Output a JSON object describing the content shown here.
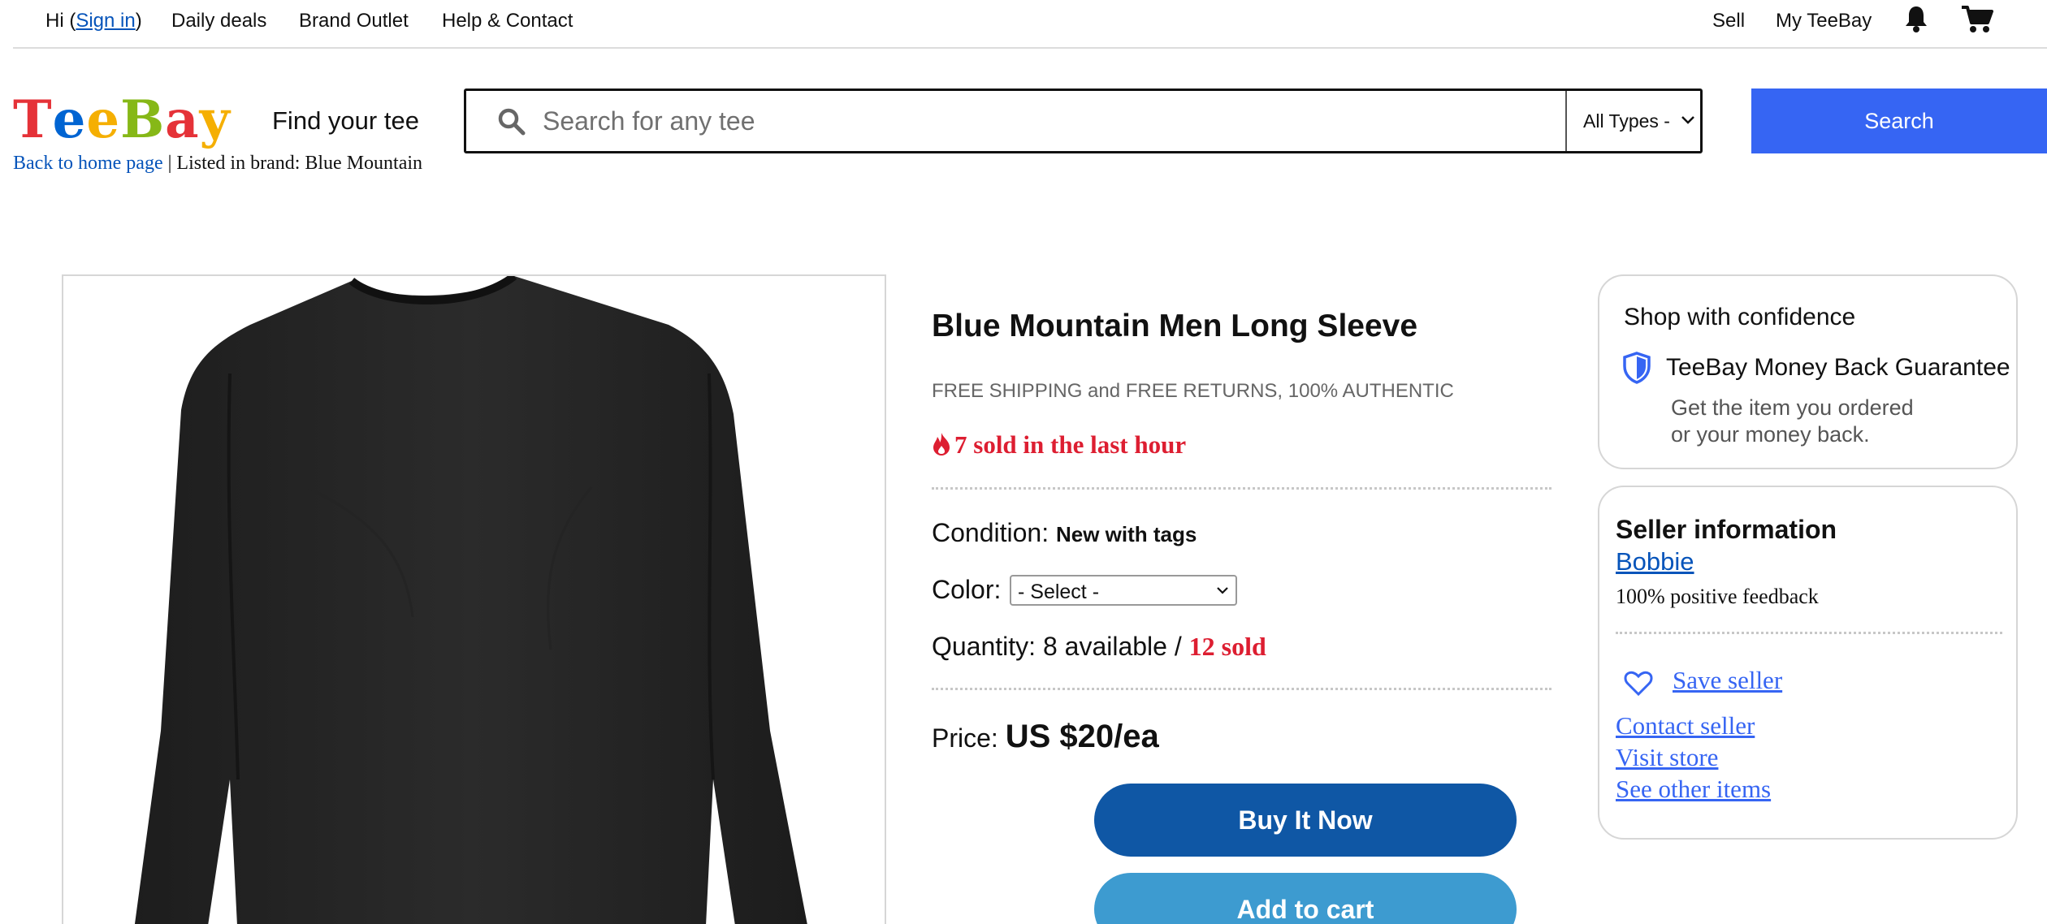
{
  "topnav": {
    "greeting_prefix": "Hi (",
    "sign_in": "Sign in",
    "greeting_suffix": ")",
    "daily_deals": "Daily deals",
    "brand_outlet": "Brand Outlet",
    "help_contact": "Help & Contact",
    "sell": "Sell",
    "my_teebay": "My TeeBay",
    "icons": [
      "bell-icon",
      "cart-icon"
    ]
  },
  "header": {
    "logo_letters": [
      {
        "char": "T",
        "color": "#e53238"
      },
      {
        "char": "e",
        "color": "#0064d2"
      },
      {
        "char": "e",
        "color": "#f5af02"
      },
      {
        "char": "B",
        "color": "#86b817"
      },
      {
        "char": "a",
        "color": "#e53238"
      },
      {
        "char": "y",
        "color": "#f5af02"
      }
    ],
    "tagline": "Find your tee",
    "back_link": "Back to home page",
    "listed_in": " | Listed in brand: Blue Mountain"
  },
  "search": {
    "placeholder": "Search for any tee",
    "category": "All Types -",
    "button": "Search"
  },
  "product": {
    "image_alt": "Black long sleeve t-shirt",
    "title": "Blue Mountain Men Long Sleeve",
    "shipping": "FREE SHIPPING and FREE RETURNS, 100% AUTHENTIC",
    "sold_last_hour": "7 sold in the last hour",
    "condition_label": "Condition:",
    "condition_value": "New with tags",
    "color_label": "Color:",
    "color_selected": "- Select -",
    "quantity_label": "Quantity: 8 available / ",
    "quantity_sold": "12 sold",
    "price_label": "Price:",
    "price_value": "US $20/ea",
    "buy_now": "Buy It Now",
    "add_to_cart": "Add to cart"
  },
  "confidence": {
    "heading": "Shop with confidence",
    "guarantee": "TeeBay Money Back Guarantee",
    "line1": "Get the item you ordered",
    "line2": "or your money back."
  },
  "seller": {
    "heading": "Seller information",
    "name": "Bobbie",
    "feedback": "100% positive feedback",
    "save": "Save seller",
    "contact": "Contact seller",
    "visit": "Visit store",
    "other": "See other items"
  },
  "colors": {
    "accent_blue": "#3665f3",
    "buy_blue": "#0f57a5",
    "cart_blue": "#3d9bd0",
    "alert_red": "#dd1e31",
    "link_blue": "#0654ba"
  }
}
